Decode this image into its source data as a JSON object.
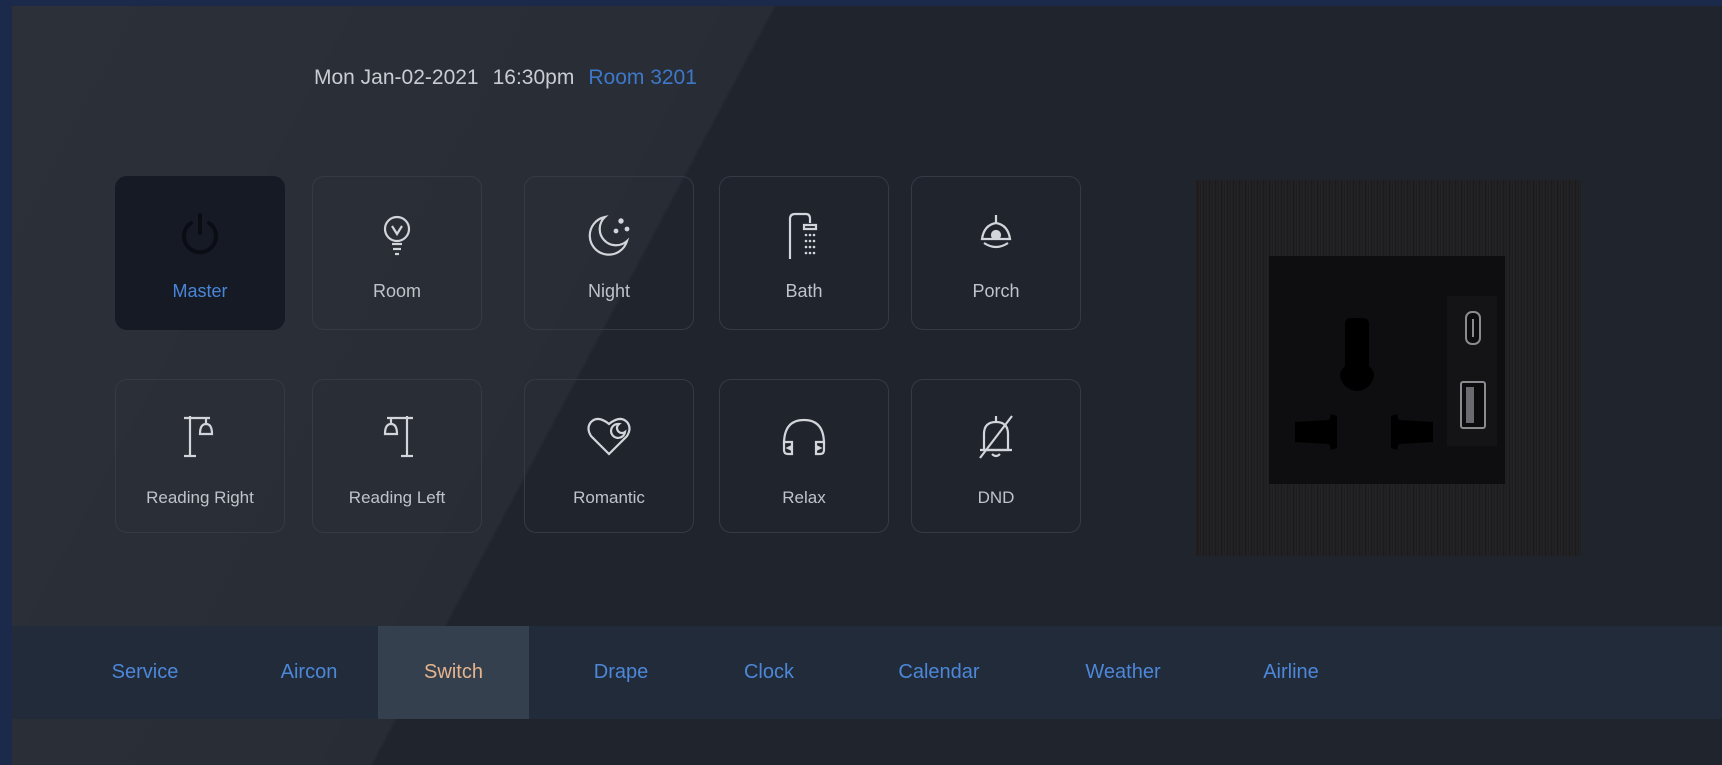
{
  "header": {
    "date": "Mon Jan-02-2021",
    "time": "16:30pm",
    "room": "Room 3201"
  },
  "scenes": [
    {
      "label": "Master",
      "icon": "power-icon",
      "active": true
    },
    {
      "label": "Room",
      "icon": "bulb-icon",
      "active": false
    },
    {
      "label": "Night",
      "icon": "moon-stars-icon",
      "active": false
    },
    {
      "label": "Bath",
      "icon": "shower-icon",
      "active": false
    },
    {
      "label": "Porch",
      "icon": "pendant-lamp-icon",
      "active": false
    },
    {
      "label": "Reading Right",
      "icon": "reading-lamp-right-icon",
      "active": false
    },
    {
      "label": "Reading Left",
      "icon": "reading-lamp-left-icon",
      "active": false
    },
    {
      "label": "Romantic",
      "icon": "heart-moon-icon",
      "active": false
    },
    {
      "label": "Relax",
      "icon": "headphones-icon",
      "active": false
    },
    {
      "label": "DND",
      "icon": "bell-off-icon",
      "active": false
    }
  ],
  "nav": {
    "tabs": [
      {
        "label": "Service",
        "active": false
      },
      {
        "label": "Aircon",
        "active": false
      },
      {
        "label": "Switch",
        "active": true
      },
      {
        "label": "Drape",
        "active": false
      },
      {
        "label": "Clock",
        "active": false
      },
      {
        "label": "Calendar",
        "active": false
      },
      {
        "label": "Weather",
        "active": false
      },
      {
        "label": "Airline",
        "active": false
      }
    ]
  },
  "colors": {
    "accent": "#4a86d8",
    "active_tab_text": "#e6b48c",
    "panel_bg": "#1f242d"
  }
}
